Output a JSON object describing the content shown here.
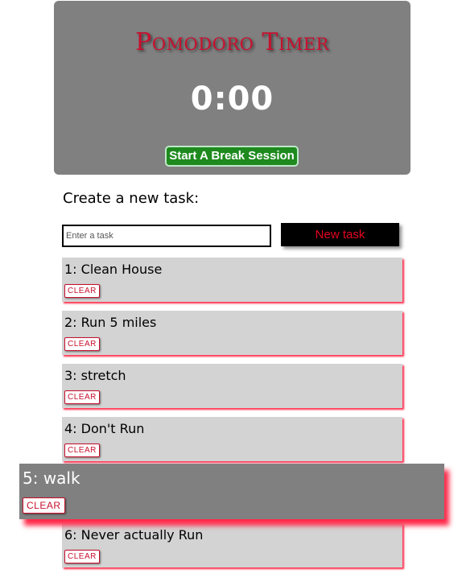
{
  "timer": {
    "title": "Pomodoro Timer",
    "display": "0:00",
    "break_button_label": "Start A Break Session"
  },
  "create": {
    "heading": "Create a new task:",
    "input_placeholder": "Enter a task",
    "input_value": "",
    "new_task_label": "New task"
  },
  "tasks": [
    {
      "label": "1: Clean House",
      "clear_label": "CLEAR"
    },
    {
      "label": "2: Run 5 miles",
      "clear_label": "CLEAR"
    },
    {
      "label": "3: stretch",
      "clear_label": "CLEAR"
    },
    {
      "label": "4: Don't Run",
      "clear_label": "CLEAR"
    },
    {
      "label": "5: walk",
      "clear_label": "CLEAR"
    },
    {
      "label": "6: Never actually Run",
      "clear_label": "CLEAR"
    }
  ],
  "colors": {
    "panel_bg": "#808080",
    "title_red": "#c8102e",
    "break_green": "#1e8a1e",
    "task_bg": "#d3d3d3",
    "task_shadow": "#ff2a4a"
  }
}
